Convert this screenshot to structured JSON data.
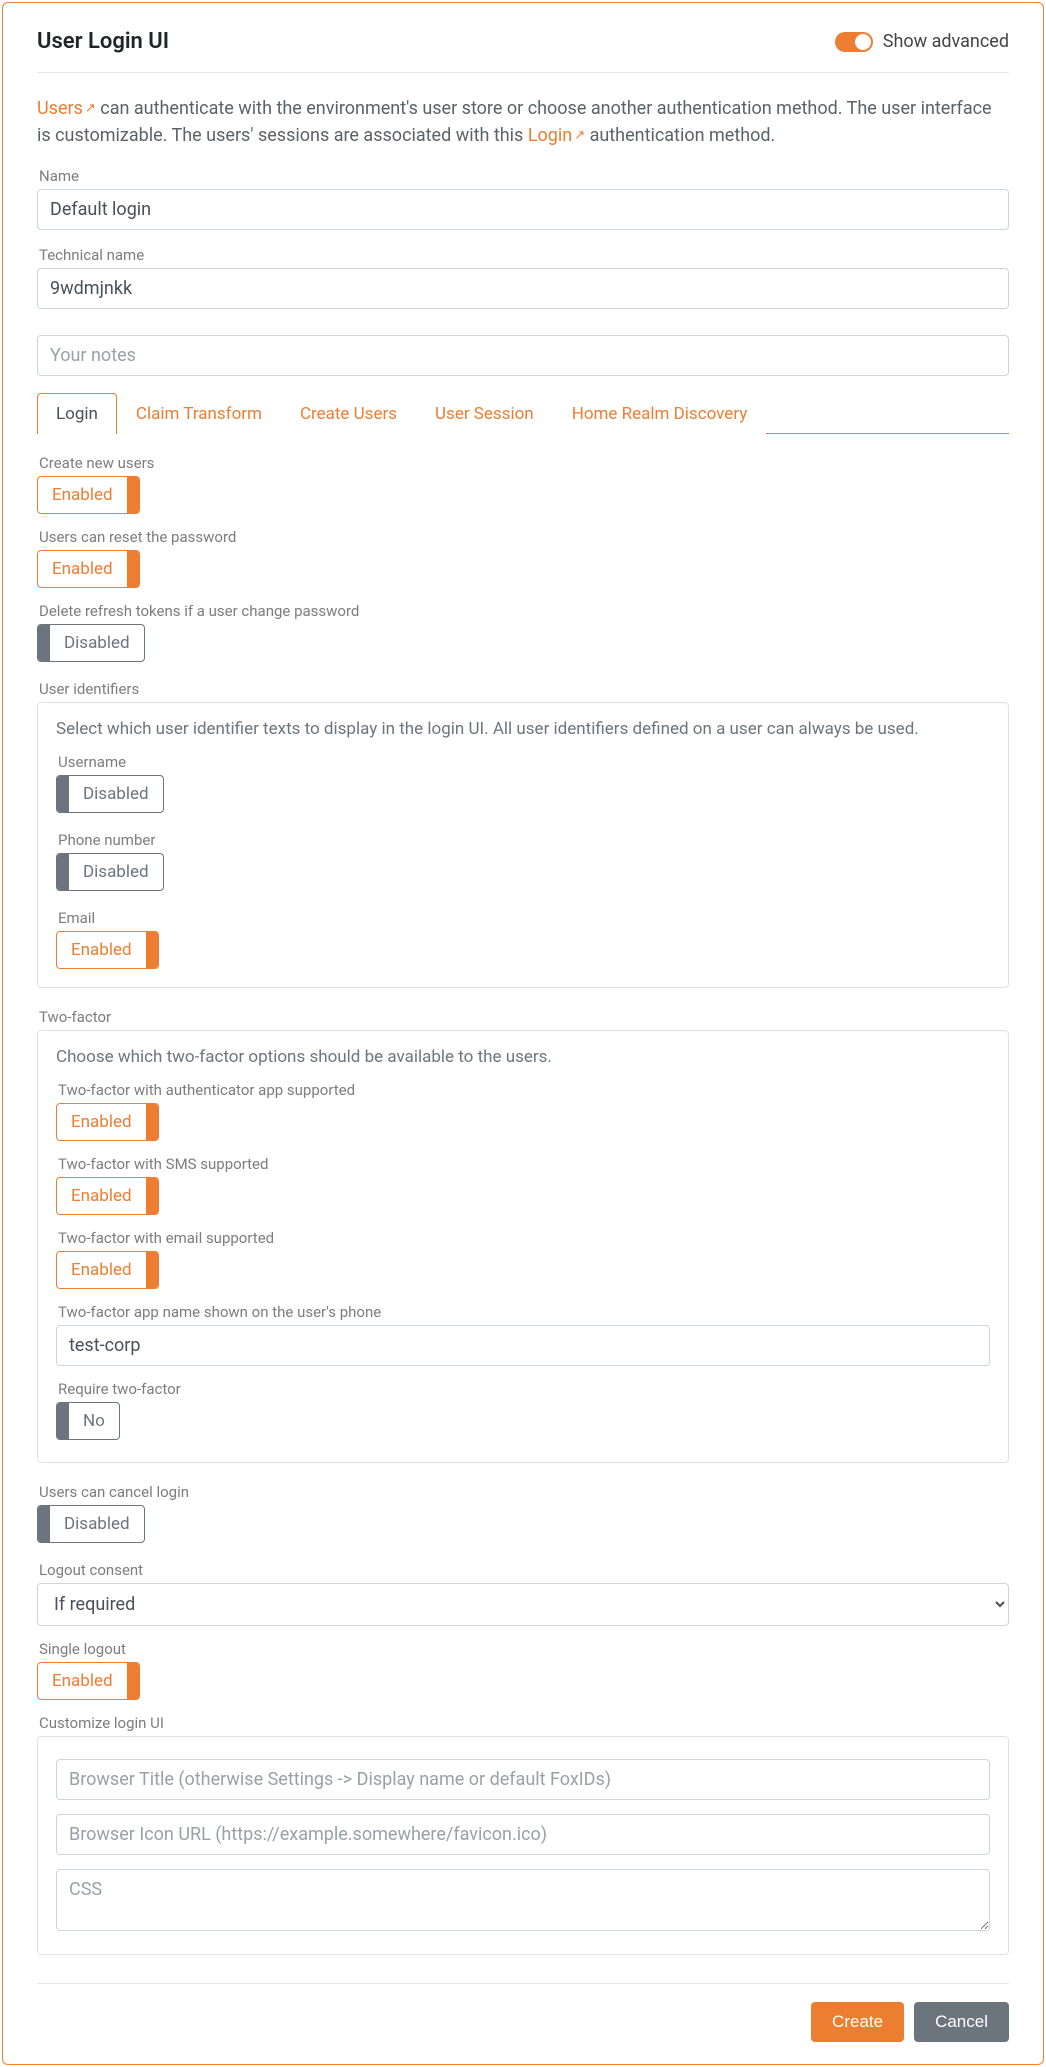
{
  "header": {
    "title": "User Login UI",
    "show_advanced_label": "Show advanced"
  },
  "intro": {
    "users_link": "Users",
    "text1": " can authenticate with the environment's user store or choose another authentication method. The user interface is customizable. The users' sessions are associated with this ",
    "login_link": "Login",
    "text2": " authentication method."
  },
  "fields": {
    "name_label": "Name",
    "name_value": "Default login",
    "technical_label": "Technical name",
    "technical_value": "9wdmjnkk",
    "notes_placeholder": "Your notes"
  },
  "tabs": {
    "login": "Login",
    "claim": "Claim Transform",
    "create_users": "Create Users",
    "user_session": "User Session",
    "hrd": "Home Realm Discovery"
  },
  "login_tab": {
    "create_users_label": "Create new users",
    "create_users_value": "Enabled",
    "reset_pw_label": "Users can reset the password",
    "reset_pw_value": "Enabled",
    "delete_tokens_label": "Delete refresh tokens if a user change password",
    "delete_tokens_value": "Disabled",
    "user_identifiers": {
      "group_label": "User identifiers",
      "desc": "Select which user identifier texts to display in the login UI. All user identifiers defined on a user can always be used.",
      "username_label": "Username",
      "username_value": "Disabled",
      "phone_label": "Phone number",
      "phone_value": "Disabled",
      "email_label": "Email",
      "email_value": "Enabled"
    },
    "two_factor": {
      "group_label": "Two-factor",
      "desc": "Choose which two-factor options should be available to the users.",
      "app_label": "Two-factor with authenticator app supported",
      "app_value": "Enabled",
      "sms_label": "Two-factor with SMS supported",
      "sms_value": "Enabled",
      "email_label": "Two-factor with email supported",
      "email_value": "Enabled",
      "app_name_label": "Two-factor app name shown on the user's phone",
      "app_name_value": "test-corp",
      "require_label": "Require two-factor",
      "require_value": "No"
    },
    "cancel_label": "Users can cancel login",
    "cancel_value": "Disabled",
    "logout_consent_label": "Logout consent",
    "logout_consent_value": "If required",
    "single_logout_label": "Single logout",
    "single_logout_value": "Enabled",
    "customize": {
      "group_label": "Customize login UI",
      "title_placeholder": "Browser Title (otherwise Settings -> Display name or default FoxIDs)",
      "icon_placeholder": "Browser Icon URL (https://example.somewhere/favicon.ico)",
      "css_placeholder": "CSS"
    }
  },
  "footer": {
    "create": "Create",
    "cancel": "Cancel"
  }
}
